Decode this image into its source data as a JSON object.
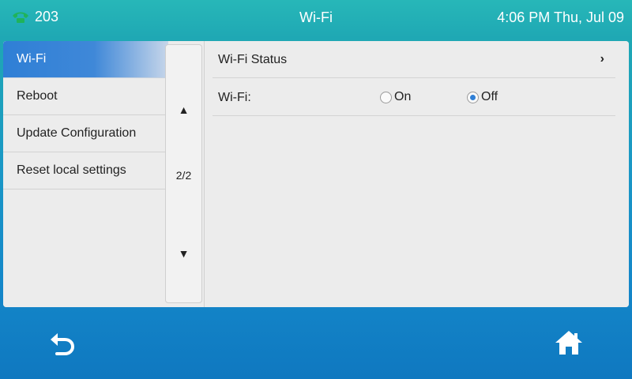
{
  "status_bar": {
    "line_number": "203",
    "title": "Wi-Fi",
    "clock": "4:06 PM Thu, Jul 09",
    "phone_icon": "phone-icon",
    "accent_color": "#1fb35a"
  },
  "menu": {
    "items": [
      {
        "label": "Wi-Fi",
        "active": true
      },
      {
        "label": "Reboot"
      },
      {
        "label": "Update Configuration"
      },
      {
        "label": "Reset local settings"
      }
    ],
    "pager": {
      "up": "▲",
      "page": "2/2",
      "down": "▼"
    }
  },
  "content": {
    "wifi_status": {
      "label": "Wi-Fi Status",
      "chevron": "›"
    },
    "wifi_toggle": {
      "label": "Wi-Fi:",
      "options": [
        {
          "label": "On",
          "checked": false
        },
        {
          "label": "Off",
          "checked": true
        }
      ]
    }
  },
  "bottom_bar": {
    "back_icon": "back-icon",
    "home_icon": "home-icon"
  },
  "colors": {
    "selection": "#2f7fd6",
    "panel": "#ececec"
  }
}
